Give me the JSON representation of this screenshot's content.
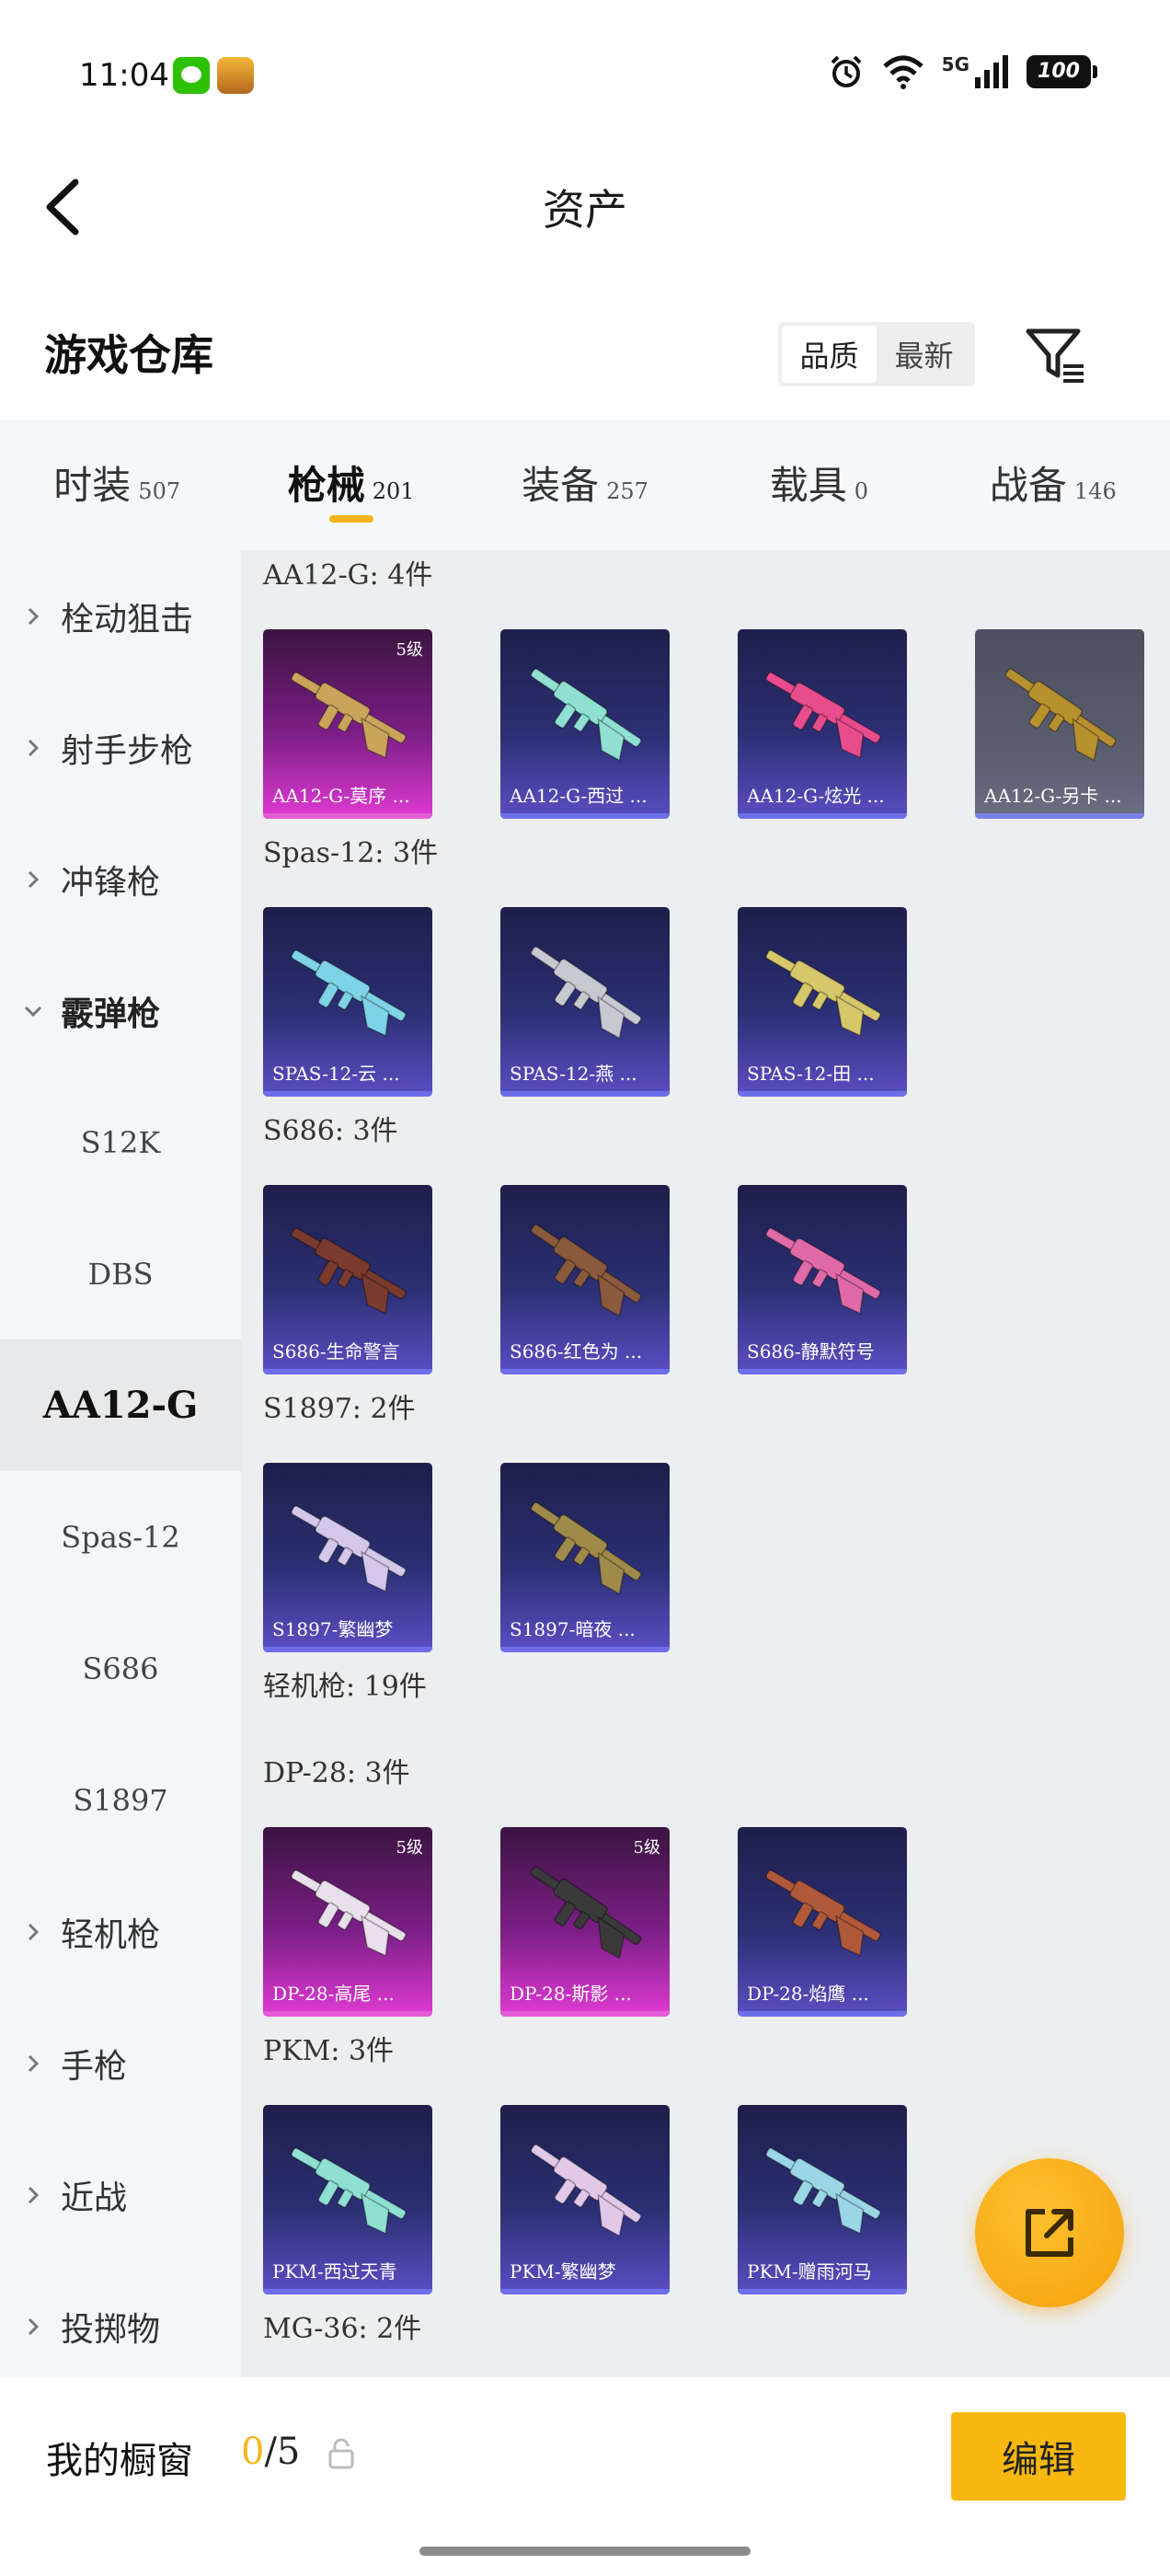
{
  "status_bar": {
    "time": "11:04",
    "network": "5G",
    "battery": "100"
  },
  "nav": {
    "title": "资产"
  },
  "warehouse": {
    "title": "游戏仓库",
    "sort_options": [
      {
        "label": "品质",
        "active": true
      },
      {
        "label": "最新",
        "active": false
      }
    ]
  },
  "tabs": [
    {
      "label": "时装",
      "count": "507",
      "active": false
    },
    {
      "label": "枪械",
      "count": "201",
      "active": true
    },
    {
      "label": "装备",
      "count": "257",
      "active": false
    },
    {
      "label": "载具",
      "count": "0",
      "active": false
    },
    {
      "label": "战备",
      "count": "146",
      "active": false
    }
  ],
  "sidebar": [
    {
      "label": "栓动狙击",
      "type": "cat",
      "expanded": false
    },
    {
      "label": "射手步枪",
      "type": "cat",
      "expanded": false
    },
    {
      "label": "冲锋枪",
      "type": "cat",
      "expanded": false
    },
    {
      "label": "霰弹枪",
      "type": "cat",
      "expanded": true
    },
    {
      "label": "S12K",
      "type": "sub"
    },
    {
      "label": "DBS",
      "type": "sub"
    },
    {
      "label": "AA12-G",
      "type": "sub",
      "selected": true
    },
    {
      "label": "Spas-12",
      "type": "sub"
    },
    {
      "label": "S686",
      "type": "sub"
    },
    {
      "label": "S1897",
      "type": "sub"
    },
    {
      "label": "轻机枪",
      "type": "cat",
      "expanded": false
    },
    {
      "label": "手枪",
      "type": "cat",
      "expanded": false
    },
    {
      "label": "近战",
      "type": "cat",
      "expanded": false
    },
    {
      "label": "投掷物",
      "type": "cat",
      "expanded": false
    }
  ],
  "groups": [
    {
      "title": "AA12-G: 4件",
      "items": [
        {
          "name": "AA12-G-莫序 ...",
          "level": "5级",
          "rarity": "pink",
          "color": "#c9a45a"
        },
        {
          "name": "AA12-G-西过 ...",
          "level": "",
          "rarity": "blue",
          "color": "#8fe0d2"
        },
        {
          "name": "AA12-G-炫光 ...",
          "level": "",
          "rarity": "blue",
          "color": "#e74c8c"
        },
        {
          "name": "AA12-G-另卡 ...",
          "level": "",
          "rarity": "grey",
          "color": "#b8912f"
        }
      ]
    },
    {
      "title": "Spas-12: 3件",
      "items": [
        {
          "name": "SPAS-12-云 ...",
          "level": "",
          "rarity": "blue",
          "color": "#7fd3e6"
        },
        {
          "name": "SPAS-12-燕 ...",
          "level": "",
          "rarity": "blue",
          "color": "#c8c8d0"
        },
        {
          "name": "SPAS-12-田 ...",
          "level": "",
          "rarity": "blue",
          "color": "#d6c76a"
        }
      ]
    },
    {
      "title": "S686: 3件",
      "items": [
        {
          "name": "S686-生命警言",
          "level": "",
          "rarity": "blue",
          "color": "#7a3a2e"
        },
        {
          "name": "S686-红色为 ...",
          "level": "",
          "rarity": "blue",
          "color": "#8a5a3c"
        },
        {
          "name": "S686-静默符号",
          "level": "",
          "rarity": "blue",
          "color": "#e06aa8"
        }
      ]
    },
    {
      "title": "S1897: 2件",
      "items": [
        {
          "name": "S1897-繁幽梦",
          "level": "",
          "rarity": "blue",
          "color": "#d4c8ea"
        },
        {
          "name": "S1897-暗夜 ...",
          "level": "",
          "rarity": "blue",
          "color": "#a08a4a"
        }
      ]
    },
    {
      "title": "轻机枪: 19件",
      "items": []
    },
    {
      "title": "DP-28: 3件",
      "items": [
        {
          "name": "DP-28-高尾 ...",
          "level": "5级",
          "rarity": "pink",
          "color": "#e8e0ea"
        },
        {
          "name": "DP-28-斯影 ...",
          "level": "5级",
          "rarity": "pink",
          "color": "#3a3a3a"
        },
        {
          "name": "DP-28-焰鹰 ...",
          "level": "",
          "rarity": "blue",
          "color": "#b0583a"
        }
      ]
    },
    {
      "title": "PKM: 3件",
      "items": [
        {
          "name": "PKM-西过天青",
          "level": "",
          "rarity": "blue",
          "color": "#8fe0d2"
        },
        {
          "name": "PKM-繁幽梦",
          "level": "",
          "rarity": "blue",
          "color": "#e2c8e8"
        },
        {
          "name": "PKM-赠雨河马",
          "level": "",
          "rarity": "blue",
          "color": "#9ad6e6"
        }
      ]
    },
    {
      "title": "MG-36: 2件",
      "items": []
    }
  ],
  "bottom": {
    "showcase_label": "我的橱窗",
    "showcase_current": "0",
    "showcase_total": "/5",
    "edit_label": "编辑"
  }
}
